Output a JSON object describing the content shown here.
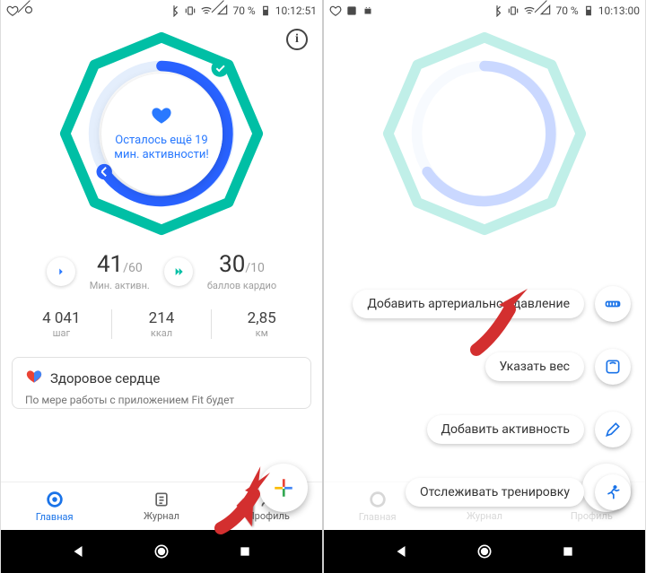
{
  "left": {
    "status": {
      "battery": "70 %",
      "time": "10:12:51"
    },
    "info_tooltip": "i",
    "center": {
      "text": "Осталось ещё 19 мин. активности!"
    },
    "metric_left": {
      "value": "41",
      "goal": "/60",
      "label": "Мин. активн."
    },
    "metric_right": {
      "value": "30",
      "goal": "/10",
      "label": "баллов кардио"
    },
    "summary": {
      "steps": {
        "value": "4 041",
        "label": "шаг"
      },
      "kcal": {
        "value": "214",
        "label": "ккал"
      },
      "km": {
        "value": "2,85",
        "label": "км"
      }
    },
    "card": {
      "title": "Здоровое сердце",
      "body": "По мере работы с приложением Fit будет"
    },
    "tabs": {
      "home": "Главная",
      "journal": "Журнал",
      "profile": "Профиль"
    }
  },
  "right": {
    "status": {
      "battery": "70 %",
      "time": "10:13:00"
    },
    "actions": {
      "bp": "Добавить артериальное давление",
      "weight": "Указать вес",
      "activity": "Добавить активность",
      "track": "Отслеживать тренировку"
    },
    "tabs": {
      "home": "Главная",
      "journal": "Журнал",
      "profile": "Профиль"
    }
  }
}
